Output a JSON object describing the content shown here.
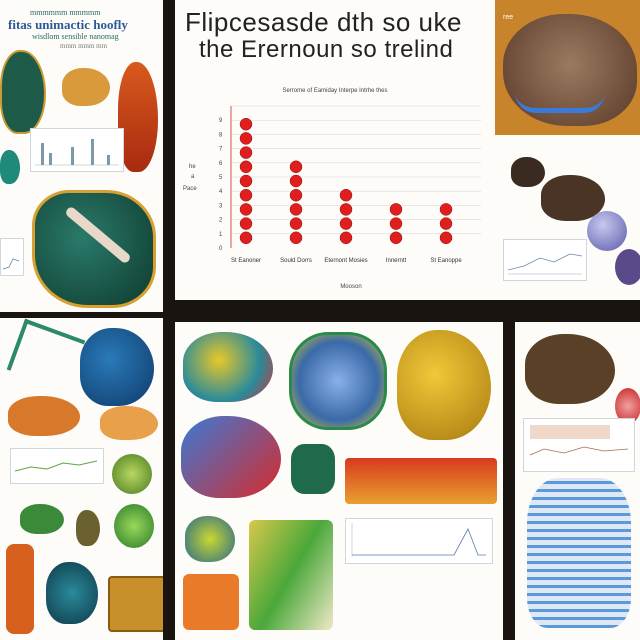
{
  "left_panel": {
    "header_line1": "mmmmmm mmmmm",
    "header_line2": "fitas unimactic hoofly",
    "header_line3": "wisdlom sensible nanomag",
    "header_line4": "mmm mmm mm"
  },
  "chart_panel": {
    "title_line1": "Flipcesasde dth so uke",
    "title_line2": "the Erernoun so trelind",
    "chart_title": "Serrome of Eamiday Interpe Intrhe thes",
    "y_side_labels": [
      "he",
      "a",
      "Pace"
    ],
    "x_footer": "Mooson"
  },
  "chart_data": {
    "type": "scatter",
    "title": "Serrome of Eamiday Interpe Intrhe thes",
    "xlabel": "Mooson",
    "ylabel": "",
    "categories": [
      "St Eanoner",
      "Sould Dorrs",
      "Eternont Mosies",
      "Innerntt",
      "St Eanoppe"
    ],
    "values": [
      9,
      6,
      4,
      3,
      3
    ],
    "ylim": [
      0,
      10
    ],
    "yticks": [
      "0",
      "1",
      "2",
      "3",
      "4",
      "5",
      "6",
      "7",
      "8",
      "9"
    ],
    "colors": {
      "marker": "#e01e1e",
      "grid": "#cfd3d8"
    }
  },
  "top_right_panel": {
    "badge": "ree"
  },
  "colors": {
    "background": "#1a1410",
    "panel": "#fdfcf8",
    "teal": "#1e6a5a",
    "blue": "#2a4f9a",
    "orange": "#d8781e",
    "red": "#d83020"
  }
}
